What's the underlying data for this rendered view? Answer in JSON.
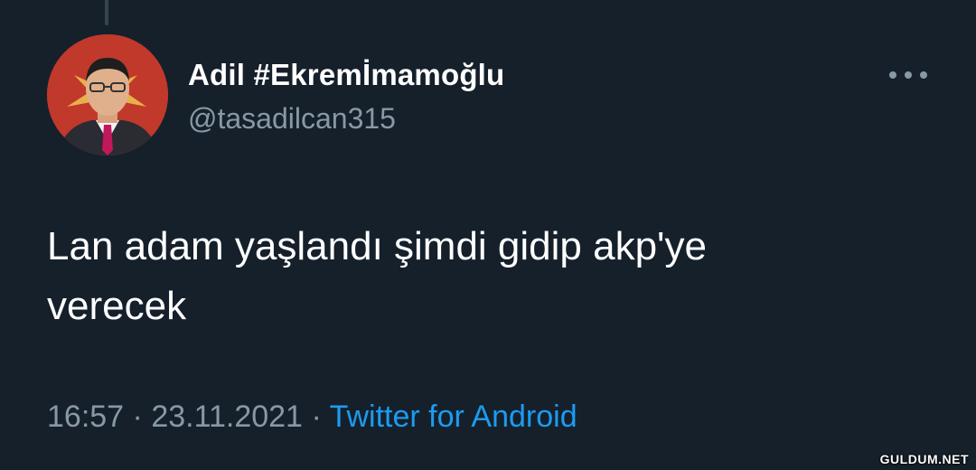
{
  "tweet": {
    "author": {
      "display_name": "Adil #Ekremİmamoğlu",
      "handle": "@tasadilcan315"
    },
    "text_line1": "Lan adam yaşlandı şimdi gidip akp'ye",
    "text_line2": "verecek",
    "time": "16:57",
    "separator": "·",
    "date": "23.11.2021",
    "source": "Twitter for Android"
  },
  "watermark": "GULDUM.NET",
  "icons": {
    "more": "more-horizontal-icon"
  },
  "colors": {
    "background": "#15202b",
    "primary_text": "#ffffff",
    "secondary_text": "#8899a6",
    "link": "#1d9bf0"
  }
}
